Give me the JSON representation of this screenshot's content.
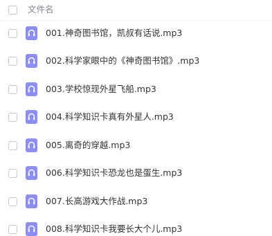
{
  "header": {
    "column_label": "文件名"
  },
  "files": [
    {
      "name": "001.神奇图书馆，凯叔有话说.mp3",
      "icon": "audio-file-icon"
    },
    {
      "name": "002.科学家眼中的《神奇图书馆》.mp3",
      "icon": "audio-file-icon"
    },
    {
      "name": "003.学校惊现外星飞船.mp3",
      "icon": "audio-file-icon"
    },
    {
      "name": "004.科学知识卡真有外星人.mp3",
      "icon": "audio-file-icon"
    },
    {
      "name": "005.离奇的穿越.mp3",
      "icon": "audio-file-icon"
    },
    {
      "name": "006.科学知识卡恐龙也是蛋生.mp3",
      "icon": "audio-file-icon"
    },
    {
      "name": "007.长高游戏大作战.mp3",
      "icon": "audio-file-icon"
    },
    {
      "name": "008.科学知识卡我要长大个儿.mp3",
      "icon": "audio-file-icon"
    }
  ],
  "colors": {
    "icon_accent": "#8a8ef5",
    "header_text": "#7f858f",
    "row_text": "#333333"
  }
}
